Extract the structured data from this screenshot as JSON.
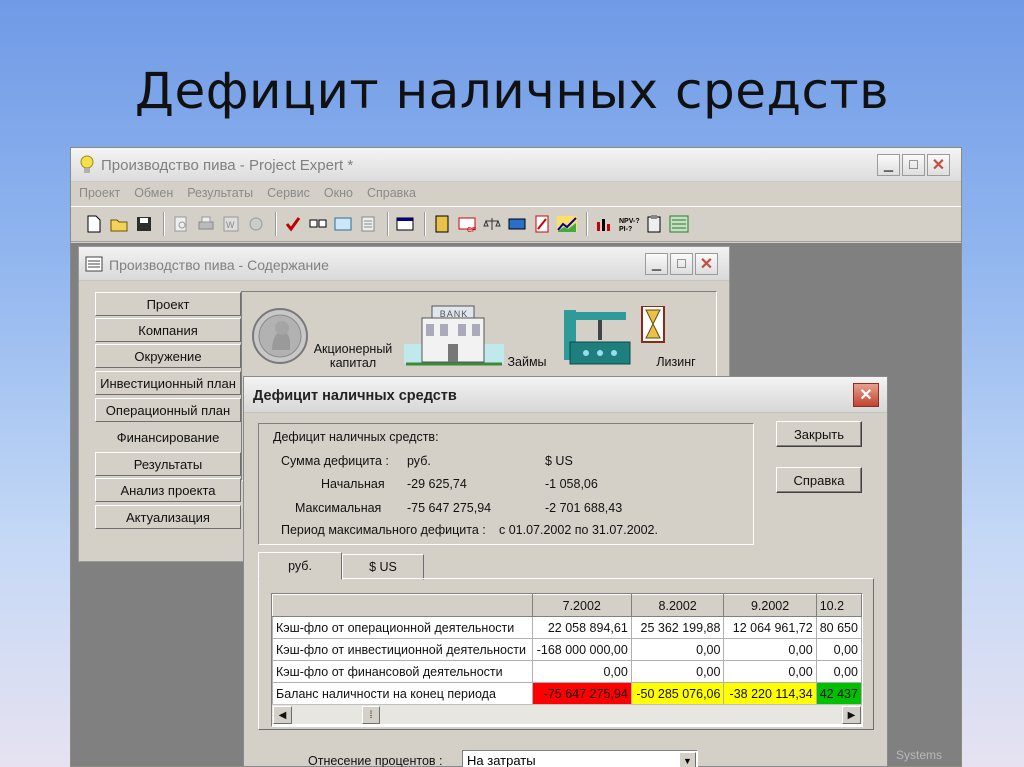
{
  "slide": {
    "title": "Дефицит наличных средств"
  },
  "app": {
    "title": "Производство пива - Project Expert *",
    "menu": [
      "Проект",
      "Обмен",
      "Результаты",
      "Сервис",
      "Окно",
      "Справка"
    ],
    "watermark": "Systems"
  },
  "content_window": {
    "title": "Производство пива - Содержание",
    "nav": [
      "Проект",
      "Компания",
      "Окружение",
      "Инвестиционный план",
      "Операционный план",
      "Финансирование",
      "Результаты",
      "Анализ проекта",
      "Актуализация"
    ],
    "active_nav": "Финансирование",
    "modules": {
      "equity_l1": "Акционерный",
      "equity_l2": "капитал",
      "bank_sign": "BANK",
      "loans": "Займы",
      "leasing": "Лизинг"
    }
  },
  "dialog": {
    "title": "Дефицит наличных средств",
    "group": {
      "heading": "Дефицит наличных средств:",
      "sum_label": "Сумма дефицита :",
      "currency_rub": "руб.",
      "currency_usd": "$ US",
      "initial_label": "Начальная",
      "initial_rub": "-29 625,74",
      "initial_usd": "-1 058,06",
      "max_label": "Максимальная",
      "max_rub": "-75 647 275,94",
      "max_usd": "-2 701 688,43",
      "period_label": "Период максимального дефицита :",
      "period_value": "с  01.07.2002  по  31.07.2002."
    },
    "buttons": {
      "close": "Закрыть",
      "help": "Справка"
    },
    "tabs": [
      "руб.",
      "$ US"
    ],
    "table": {
      "columns": [
        "7.2002",
        "8.2002",
        "9.2002",
        "10.2"
      ],
      "rows": [
        {
          "label": "Кэш-фло от операционной деятельности",
          "values": [
            "22 058 894,61",
            "25 362 199,88",
            "12 064 961,72",
            "80 650"
          ]
        },
        {
          "label": "Кэш-фло от инвестиционной деятельности",
          "values": [
            "-168 000 000,00",
            "0,00",
            "0,00",
            "0,00"
          ]
        },
        {
          "label": "Кэш-фло от финансовой деятельности",
          "values": [
            "0,00",
            "0,00",
            "0,00",
            "0,00"
          ]
        },
        {
          "label": "Баланс наличности на конец периода",
          "values": [
            "-75 647 275,94",
            "-50 285 076,06",
            "-38 220 114,34",
            "42 437"
          ]
        }
      ],
      "balance_colors": [
        "#ff0000",
        "#ffff00",
        "#ffff00",
        "#00c000"
      ]
    },
    "interest_label": "Отнесение процентов :",
    "interest_value": "На затраты"
  }
}
